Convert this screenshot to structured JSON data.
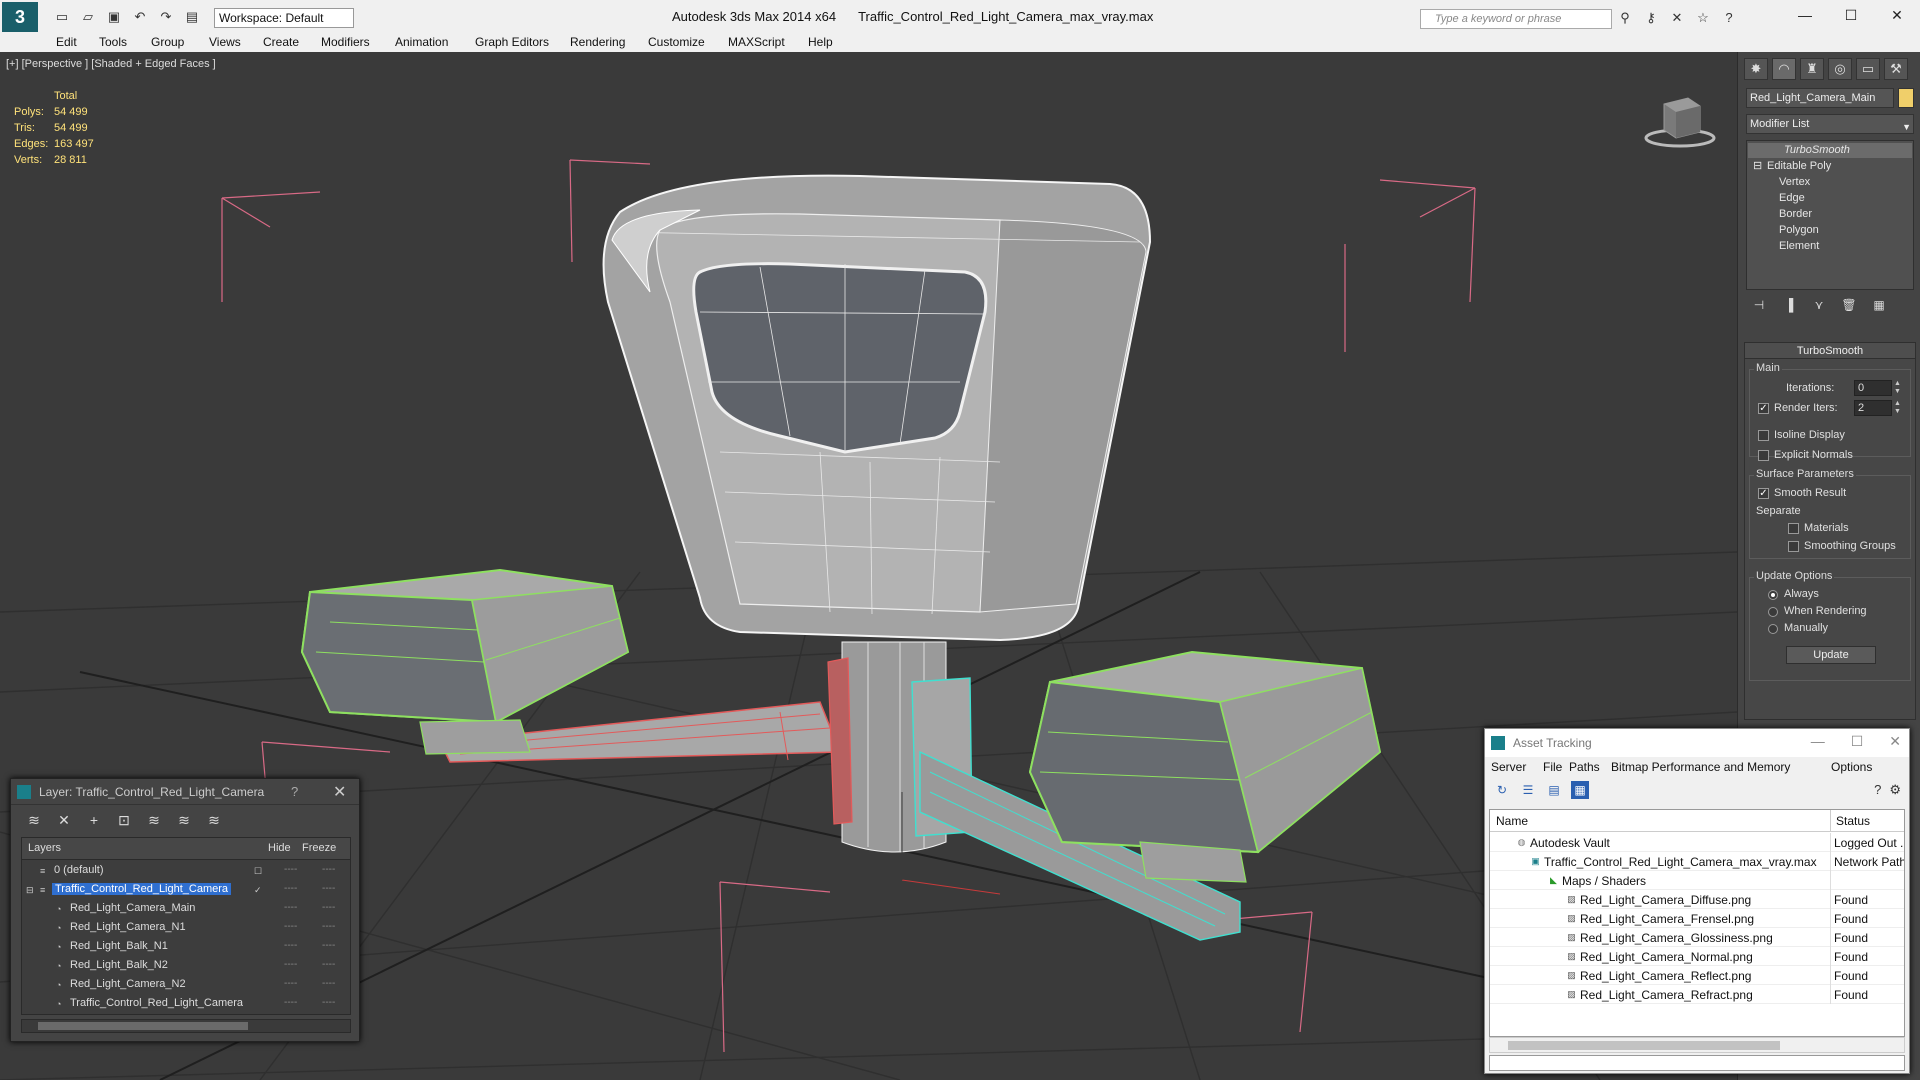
{
  "titlebar": {
    "workspace": "Workspace: Default",
    "app_title": "Autodesk 3ds Max  2014 x64",
    "file_title": "Traffic_Control_Red_Light_Camera_max_vray.max",
    "search_placeholder": "Type a keyword or phrase"
  },
  "menu": [
    "Edit",
    "Tools",
    "Group",
    "Views",
    "Create",
    "Modifiers",
    "Animation",
    "Graph Editors",
    "Rendering",
    "Customize",
    "MAXScript",
    "Help"
  ],
  "viewport": {
    "label": "[+] [Perspective ] [Shaded + Edged Faces ]",
    "stats": {
      "header": "Total",
      "rows": [
        {
          "k": "Polys:",
          "v": "54 499"
        },
        {
          "k": "Tris:",
          "v": "54 499"
        },
        {
          "k": "Edges:",
          "v": "163 497"
        },
        {
          "k": "Verts:",
          "v": "28 811"
        }
      ]
    }
  },
  "command_panel": {
    "object_name": "Red_Light_Camera_Main",
    "object_color": "#f0cf6a",
    "modifier_list": "Modifier List",
    "stack": {
      "turbosmooth": "TurboSmooth",
      "editable_poly": "Editable Poly",
      "subobjects": [
        "Vertex",
        "Edge",
        "Border",
        "Polygon",
        "Element"
      ]
    },
    "turbosmooth": {
      "header": "TurboSmooth",
      "main_group": "Main",
      "iterations_label": "Iterations:",
      "iterations": "0",
      "render_iters_label": "Render Iters:",
      "render_iters": "2",
      "isoline": "Isoline Display",
      "explicit_normals": "Explicit Normals",
      "surface_group": "Surface Parameters",
      "smooth_result": "Smooth Result",
      "separate": "Separate",
      "materials": "Materials",
      "smoothing_groups": "Smoothing Groups",
      "update_group": "Update Options",
      "always": "Always",
      "when_rendering": "When Rendering",
      "manually": "Manually",
      "update_button": "Update"
    }
  },
  "layer_window": {
    "title": "Layer: Traffic_Control_Red_Light_Camera",
    "help": "?",
    "columns": {
      "layers": "Layers",
      "hide": "Hide",
      "freeze": "Freeze"
    },
    "rows": [
      {
        "name": "0 (default)"
      },
      {
        "name": "Traffic_Control_Red_Light_Camera"
      },
      {
        "name": "Red_Light_Camera_Main"
      },
      {
        "name": "Red_Light_Camera_N1"
      },
      {
        "name": "Red_Light_Balk_N1"
      },
      {
        "name": "Red_Light_Balk_N2"
      },
      {
        "name": "Red_Light_Camera_N2"
      },
      {
        "name": "Traffic_Control_Red_Light_Camera"
      }
    ],
    "dash": "----"
  },
  "asset_tracking": {
    "title": "Asset Tracking",
    "menu": [
      "Server",
      "File",
      "Paths",
      "Bitmap Performance and Memory",
      "Options"
    ],
    "columns": {
      "name": "Name",
      "status": "Status"
    },
    "rows": [
      {
        "name": "Autodesk Vault",
        "status": "Logged Out ..."
      },
      {
        "name": "Traffic_Control_Red_Light_Camera_max_vray.max",
        "status": "Network Path"
      },
      {
        "name": "Maps / Shaders",
        "status": ""
      },
      {
        "name": "Red_Light_Camera_Diffuse.png",
        "status": "Found"
      },
      {
        "name": "Red_Light_Camera_Frensel.png",
        "status": "Found"
      },
      {
        "name": "Red_Light_Camera_Glossiness.png",
        "status": "Found"
      },
      {
        "name": "Red_Light_Camera_Normal.png",
        "status": "Found"
      },
      {
        "name": "Red_Light_Camera_Reflect.png",
        "status": "Found"
      },
      {
        "name": "Red_Light_Camera_Refract.png",
        "status": "Found"
      }
    ]
  },
  "colors": {
    "viewport_bg": "#3a3a3a",
    "selection_green": "#8ee060",
    "red_wire": "#e06060",
    "cyan_wire": "#40e0d0",
    "stats_yellow": "#ffe27a"
  }
}
